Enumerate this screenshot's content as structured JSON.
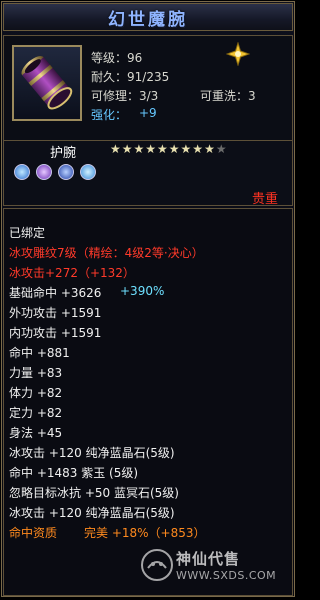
{
  "item": {
    "title": "幻世魔腕",
    "level": "等级：96",
    "durability": "耐久：91/235",
    "repair": "可修理：3/3",
    "rewash": "可重洗：3",
    "strengthen_label": "强化：",
    "strengthen_value": "+9",
    "slot": "护腕",
    "stars_filled": 9,
    "stars_total": 10,
    "binding": "贵重"
  },
  "attributes": {
    "bound": "已绑定",
    "line1": "冰攻雕纹7级（精绘：4级2等·决心）",
    "line2": "冰攻击+272（+132）",
    "line3a": "基础命中 +3626",
    "line3b": "+390%",
    "line4": "外功攻击 +1591",
    "line5": "内功攻击 +1591",
    "line6": "命中 +881",
    "line7": "力量 +83",
    "line8": "体力 +82",
    "line9": "定力 +82",
    "line10": "身法 +45",
    "line11": "冰攻击 +120 纯净蓝晶石(5级)",
    "line12": "命中 +1483 紫玉 (5级)",
    "line13": "忽略目标冰抗 +50 蓝冥石(5级)",
    "line14": "冰攻击 +120 纯净蓝晶石(5级)",
    "line15a": "命中资质",
    "line15b": "完美 +18%（+853）"
  },
  "watermark": {
    "brand": "神仙代售",
    "url": "WWW.SXDS.COM"
  },
  "colors": {
    "title": "#8fb4ff",
    "red": "#ff3a2a",
    "blue": "#6cc6ff",
    "orange": "#ff8a1e"
  }
}
